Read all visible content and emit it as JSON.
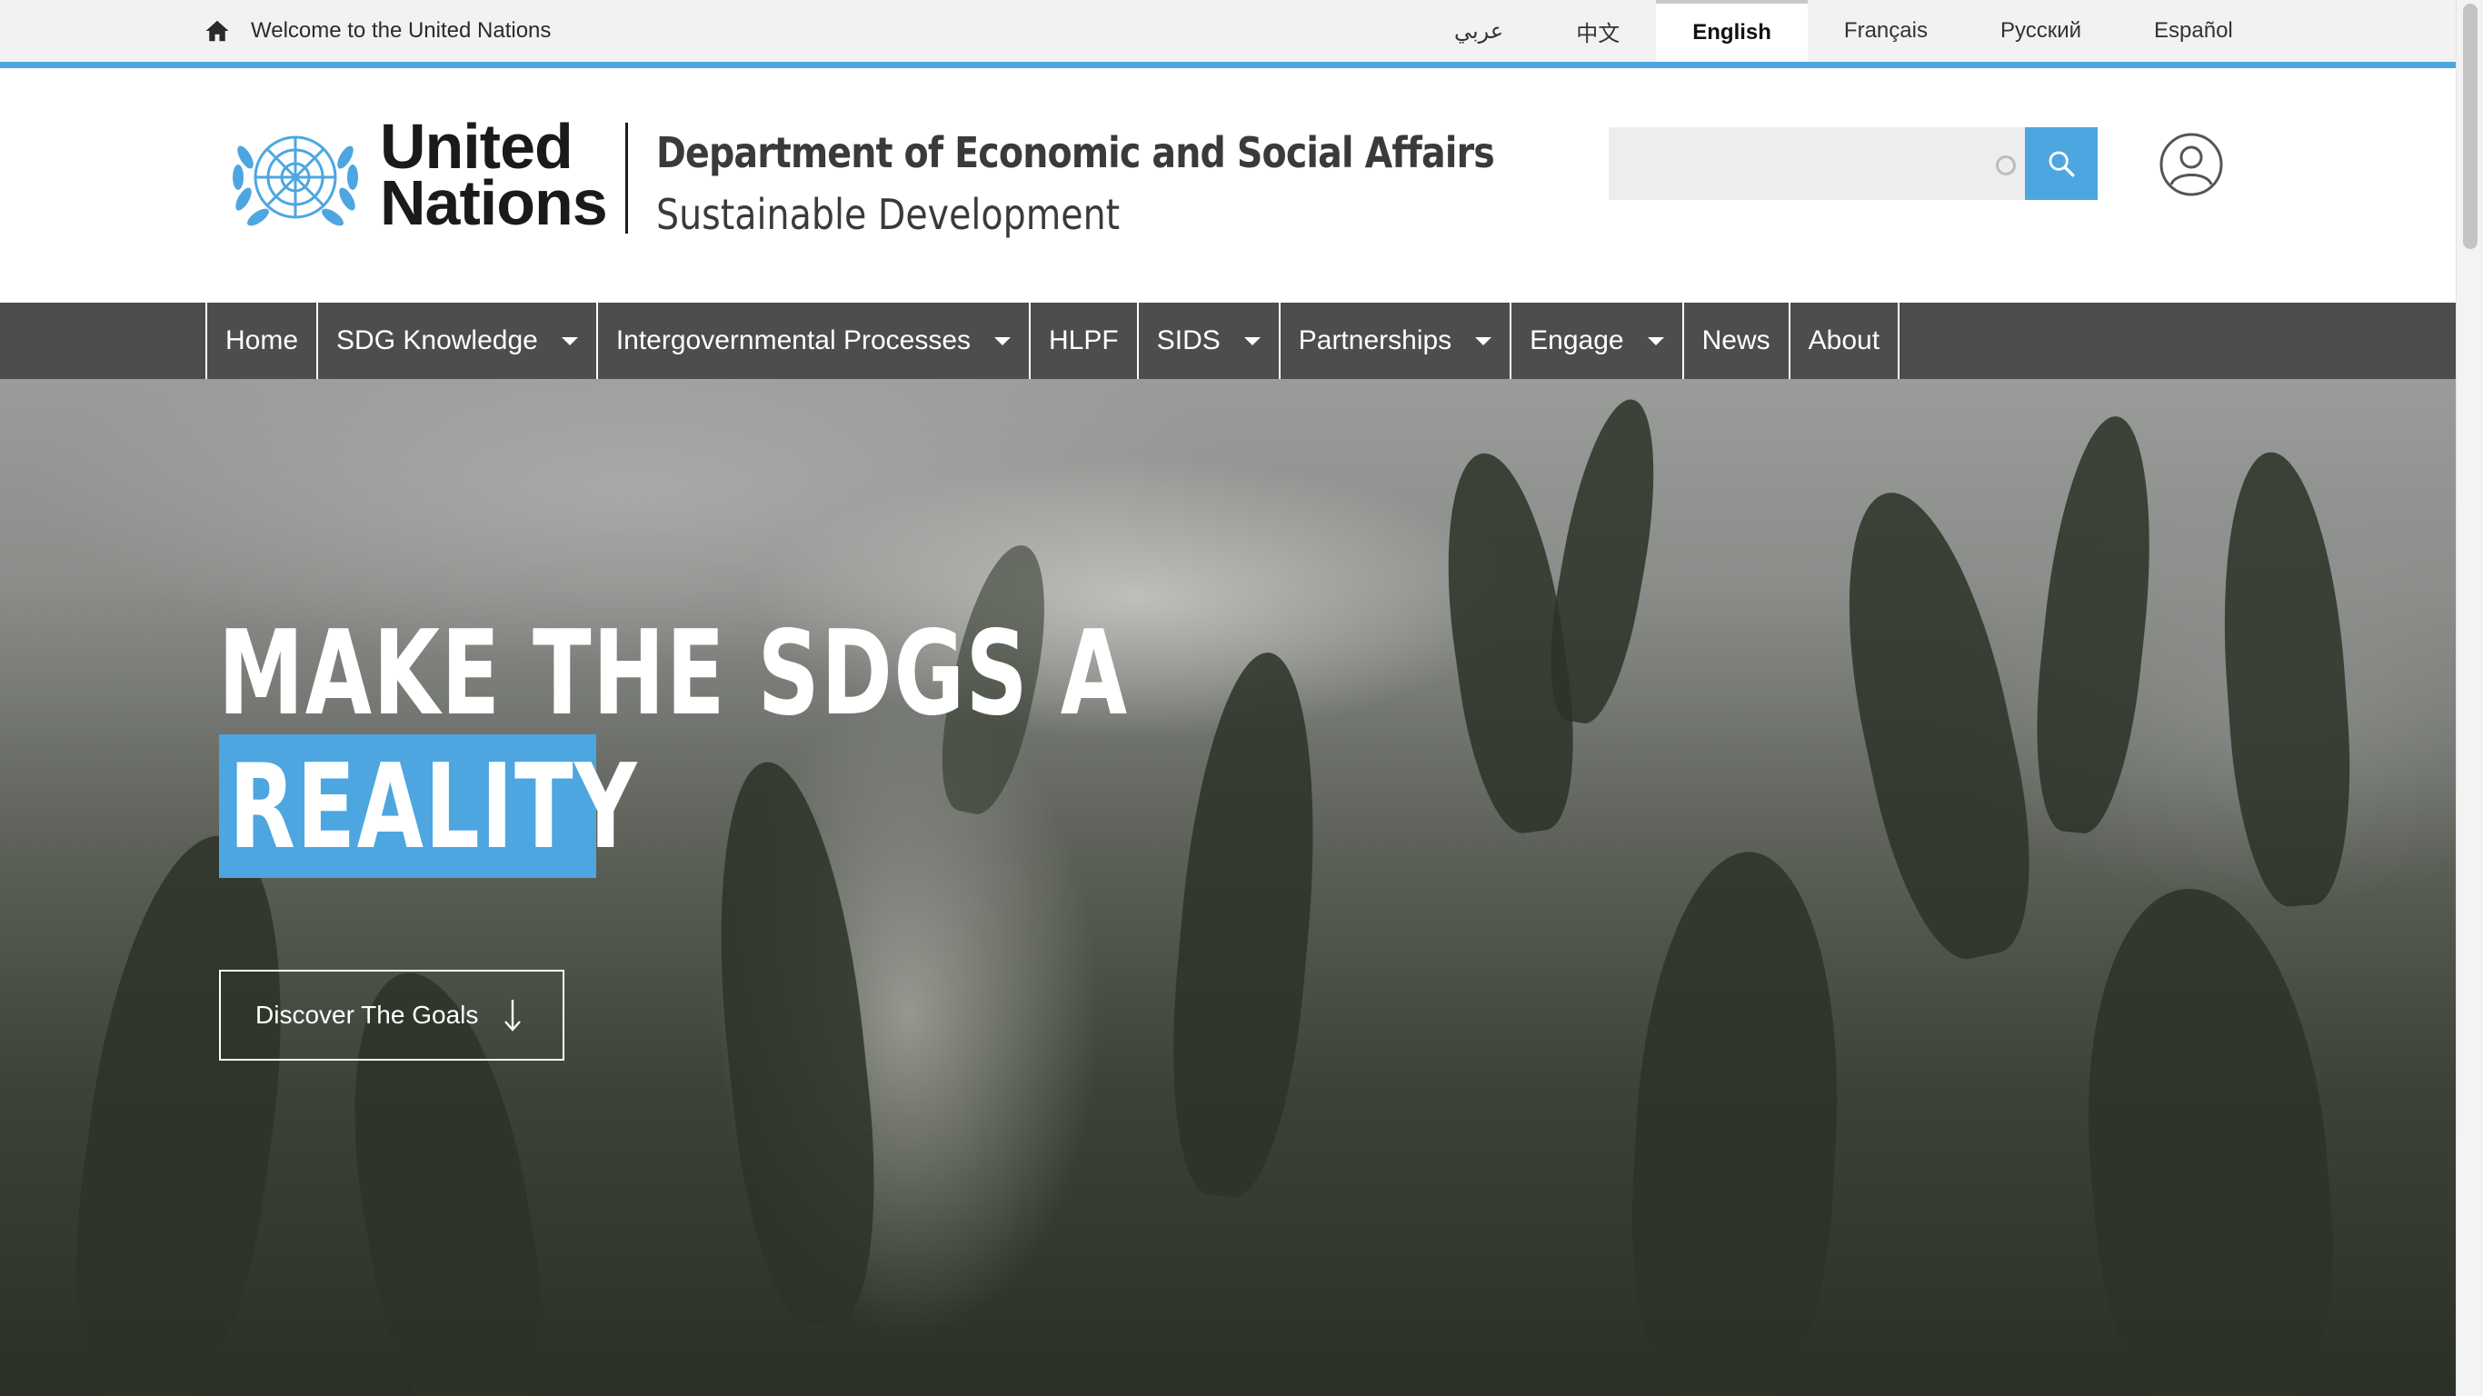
{
  "topbar": {
    "welcome_text": "Welcome to the United Nations",
    "home_icon": "home-icon",
    "languages": [
      "عربي",
      "中文",
      "English",
      "Français",
      "Русский",
      "Español"
    ],
    "active_language": "English"
  },
  "header": {
    "logo_line1": "United",
    "logo_line2": "Nations",
    "department": "Department of Economic and Social Affairs",
    "subtitle": "Sustainable Development",
    "search_placeholder": "",
    "search_icon": "search-icon",
    "user_icon": "user-icon"
  },
  "nav": {
    "items": [
      {
        "label": "Home",
        "dropdown": false
      },
      {
        "label": "SDG Knowledge",
        "dropdown": true
      },
      {
        "label": "Intergovernmental Processes",
        "dropdown": true
      },
      {
        "label": "HLPF",
        "dropdown": false
      },
      {
        "label": "SIDS",
        "dropdown": true
      },
      {
        "label": "Partnerships",
        "dropdown": true
      },
      {
        "label": "Engage",
        "dropdown": true
      },
      {
        "label": "News",
        "dropdown": false
      },
      {
        "label": "About",
        "dropdown": false
      }
    ]
  },
  "hero": {
    "line1": "MAKE THE SDGS A",
    "line2": "REALITY",
    "button_label": "Discover The Goals",
    "button_icon": "arrow-down-icon"
  },
  "colors": {
    "accent": "#4da6e0",
    "nav_bg": "#4d4d4d",
    "topbar_bg": "#f2f2f2"
  }
}
